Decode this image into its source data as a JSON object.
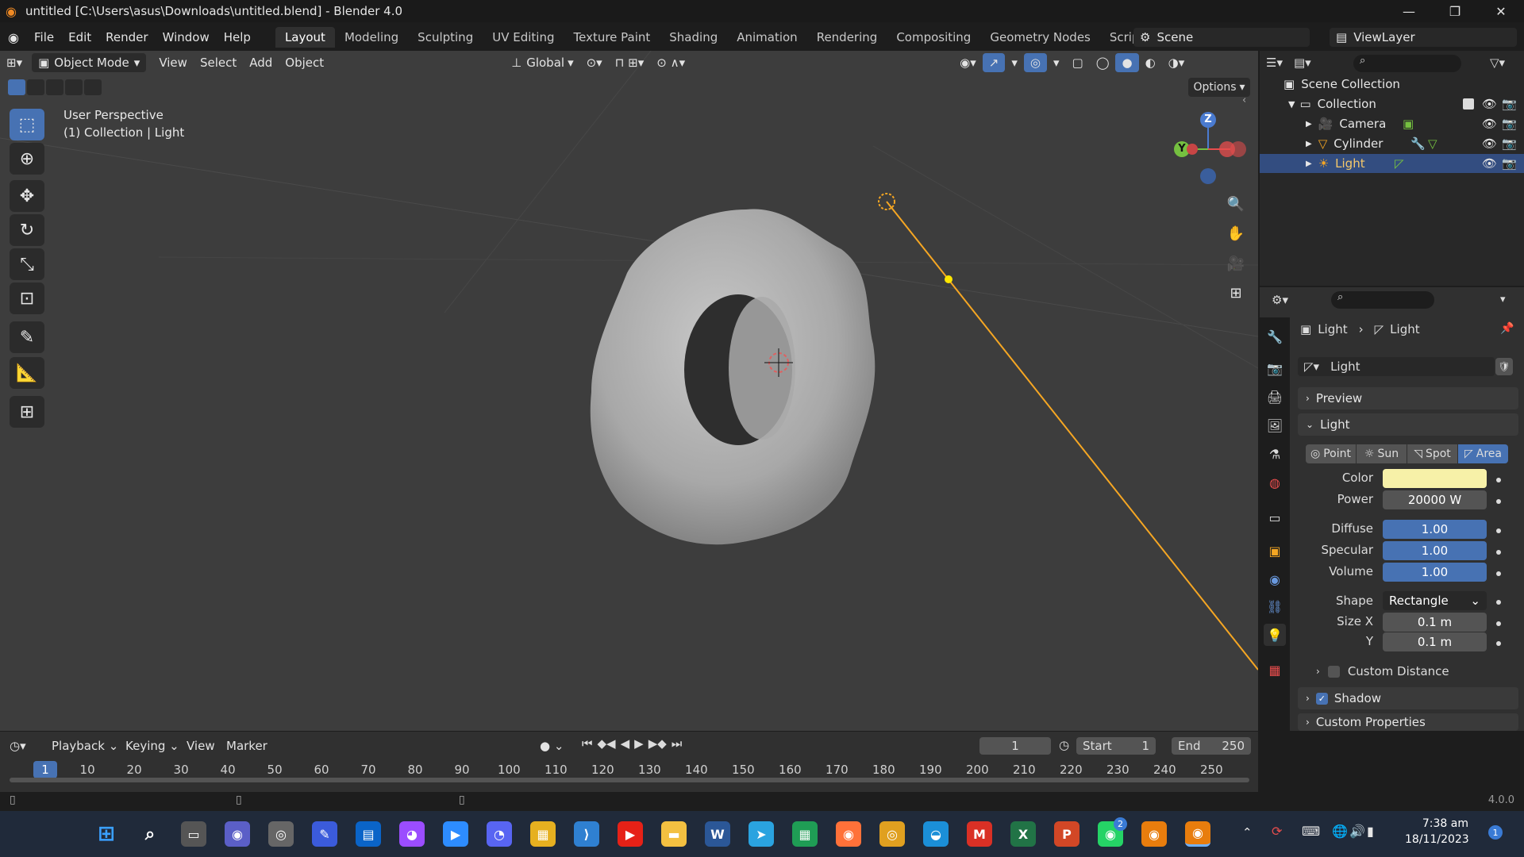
{
  "titlebar": {
    "title": "untitled [C:\\Users\\asus\\Downloads\\untitled.blend] - Blender 4.0",
    "minimize": "—",
    "maximize": "❐",
    "close": "✕"
  },
  "menubar": {
    "menus": [
      "File",
      "Edit",
      "Render",
      "Window",
      "Help"
    ],
    "workspaces": [
      "Layout",
      "Modeling",
      "Sculpting",
      "UV Editing",
      "Texture Paint",
      "Shading",
      "Animation",
      "Rendering",
      "Compositing",
      "Geometry Nodes",
      "Scripting"
    ],
    "active_workspace": "Layout",
    "add_tab": "+",
    "scene": "Scene",
    "view_layer": "ViewLayer"
  },
  "viewport_header": {
    "mode": "Object Mode",
    "menus": [
      "View",
      "Select",
      "Add",
      "Object"
    ],
    "orientation": "Global",
    "options": "Options"
  },
  "viewport": {
    "perspective": "User Perspective",
    "context": "(1) Collection | Light",
    "gizmo": {
      "z": "Z",
      "y": "Y"
    }
  },
  "outliner": {
    "root": "Scene Collection",
    "collection": "Collection",
    "items": [
      {
        "name": "Camera",
        "selected": false
      },
      {
        "name": "Cylinder",
        "selected": false
      },
      {
        "name": "Light",
        "selected": true
      }
    ]
  },
  "properties": {
    "breadcrumb": [
      "Light",
      "Light"
    ],
    "datablock": "Light",
    "panels": {
      "preview": "Preview",
      "light": "Light",
      "custom_distance": "Custom Distance",
      "shadow": "Shadow",
      "custom_properties": "Custom Properties"
    },
    "light_types": [
      "Point",
      "Sun",
      "Spot",
      "Area"
    ],
    "active_light_type": "Area",
    "color_label": "Color",
    "color_value": "#f7f1a8",
    "power": {
      "label": "Power",
      "value": "20000 W"
    },
    "diffuse": {
      "label": "Diffuse",
      "value": "1.00"
    },
    "specular": {
      "label": "Specular",
      "value": "1.00"
    },
    "volume": {
      "label": "Volume",
      "value": "1.00"
    },
    "shape": {
      "label": "Shape",
      "value": "Rectangle"
    },
    "size_x": {
      "label": "Size X",
      "value": "0.1 m"
    },
    "size_y": {
      "label": "Y",
      "value": "0.1 m"
    },
    "shadow_checked": true,
    "custom_distance_checked": false
  },
  "timeline": {
    "menus": [
      "Playback",
      "Keying",
      "View",
      "Marker"
    ],
    "current_frame": "1",
    "start_label": "Start",
    "start": "1",
    "end_label": "End",
    "end": "250",
    "ruler": [
      "1",
      "10",
      "20",
      "30",
      "40",
      "50",
      "60",
      "70",
      "80",
      "90",
      "100",
      "110",
      "120",
      "130",
      "140",
      "150",
      "160",
      "170",
      "180",
      "190",
      "200",
      "210",
      "220",
      "230",
      "240",
      "250"
    ]
  },
  "statusbar": {
    "version": "4.0.0"
  },
  "taskbar": {
    "time": "7:38 am",
    "date": "18/11/2023",
    "whatsapp_badge": "2",
    "notification_badge": "1"
  },
  "colors": {
    "accent": "#4772b3",
    "selection": "#f5a623",
    "viewport_bg": "#3d3d3d"
  }
}
